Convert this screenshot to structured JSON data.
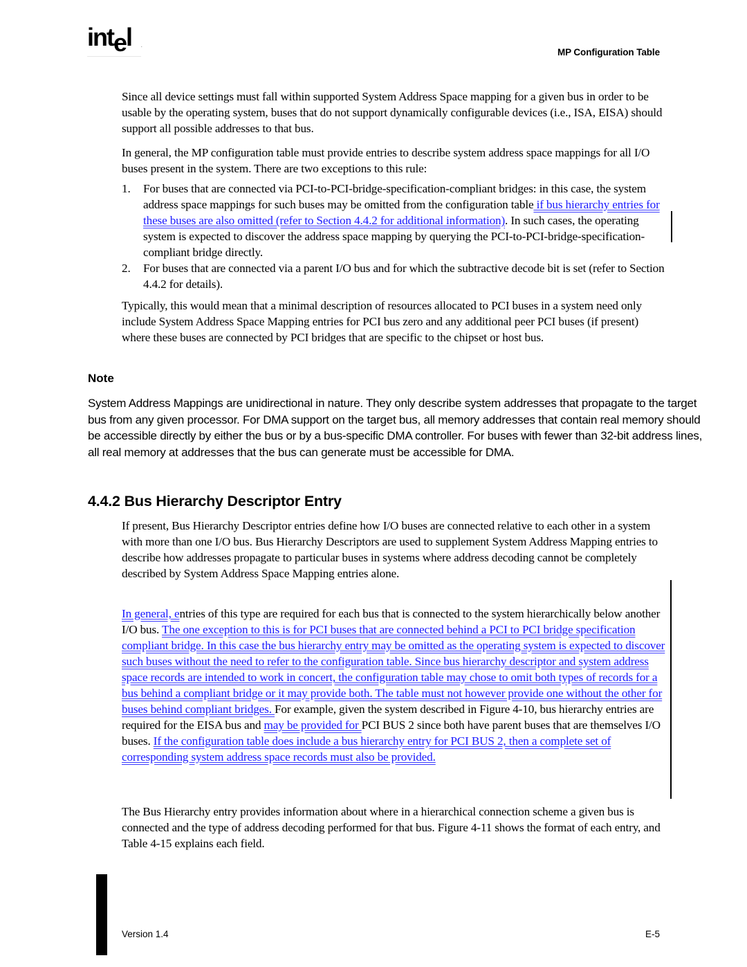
{
  "header": {
    "logo_text_a": "int",
    "logo_text_e": "e",
    "logo_text_b": "l",
    "logo_dot": ".",
    "title": "MP Configuration Table"
  },
  "body": {
    "p1": "Since all device settings must fall within supported System Address Space mapping for a given bus in order to be usable by the operating system, buses that do not support dynamically configurable devices (i.e., ISA, EISA) should support all possible addresses to that bus.",
    "p2": "In general, the MP configuration table must provide entries to describe system address space mappings for all I/O buses present in the system.  There are two exceptions to this rule:",
    "list": [
      {
        "number": "1.",
        "text_a": "For buses that are connected via PCI-to-PCI-bridge-specification-compliant bridges: in this case, the system address space mappings for such buses may be omitted from the configuration table",
        "link_a": " if bus hierarchy entries for these buses are also omitted (refer to Section 4.4.2 for additional information)",
        "text_b": ". In such cases, the operating system is expected to discover the address space mapping by querying the PCI-to-PCI-bridge-specification-compliant bridge directly."
      },
      {
        "number": "2.",
        "text_a": "For buses that are connected via a parent I/O bus and for which the subtractive decode bit is set (refer to Section 4.4.2 for details)."
      }
    ],
    "p3": "Typically, this would mean that a minimal description of resources allocated to PCI buses in a system need only include System Address Space Mapping entries for PCI bus zero and any additional peer PCI buses (if present) where these buses are connected by PCI bridges that are specific to the chipset or host bus."
  },
  "note": {
    "heading": "Note",
    "text": "System Address Mappings are unidirectional in nature. They only describe system addresses that propagate to the target bus from any given processor. For DMA support on the target bus,  all memory addresses that contain real memory should be accessible directly by either the bus or by a bus-specific DMA controller.  For buses with fewer than 32-bit address lines, all real memory at addresses that the bus can generate must be accessible for DMA."
  },
  "section": {
    "heading": "4.4.2  Bus Hierarchy Descriptor Entry",
    "p1": "If present, Bus Hierarchy Descriptor entries define how I/O buses are connected relative to each other in a system with more than one I/O bus.  Bus Hierarchy Descriptors are used to supplement System Address Mapping entries to describe how addresses propagate to particular buses in systems where address decoding cannot be completely described by System Address Space Mapping entries alone.",
    "p2": {
      "link_1": "In general, e",
      "text_1": "ntries of this type are required for each bus that is connected to the system hierarchically below another I/O bus.  ",
      "link_2": "The one exception to this is for PCI buses that are connected behind a PCI to PCI bridge specification compliant bridge.  In this case the bus hierarchy entry may be omitted as the operating system is expected to discover such buses without the need to refer to the configuration table.  Since bus hierarchy descriptor and system address space records are intended to work in concert, the configuration table may chose to omit both types of records for a bus behind a compliant bridge or it may provide both.  The table must not however provide one without the other for buses behind compliant bridges.  ",
      "text_2": "For example, given the system described in Figure 4-10, bus hierarchy entries are required for the EISA bus and ",
      "link_3": "may be provided for ",
      "text_3": " PCI BUS 2 since both have parent buses that are themselves I/O buses. ",
      "link_4": " If the configuration table does include a bus hierarchy entry for PCI BUS 2, then a complete set of corresponding system address space records must also be provided."
    },
    "p3": "The Bus Hierarchy entry provides information about where in a hierarchical connection scheme a given bus is connected and the type of address decoding performed for that bus. Figure 4-11 shows the format of each entry, and Table 4-15 explains each field."
  },
  "footer": {
    "version": "Version 1.4",
    "page": "E-5"
  },
  "colors": {
    "link": "#1a1aff",
    "text": "#000000",
    "background": "#ffffff"
  }
}
